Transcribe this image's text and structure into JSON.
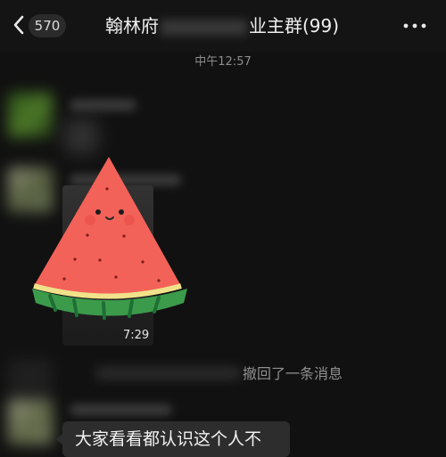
{
  "header": {
    "back_count": "570",
    "title_prefix": "翰林府",
    "title_suffix": "业主群(99)"
  },
  "chat": {
    "timestamp": "中午12:57",
    "video_duration": "7:29",
    "recall_notice": "撤回了一条消息",
    "last_message": "大家看看都认识这个人不"
  },
  "colors": {
    "background": "#111111",
    "header": "#141414",
    "bubble": "#2d2d2d",
    "muted_text": "#8f8f8f"
  }
}
